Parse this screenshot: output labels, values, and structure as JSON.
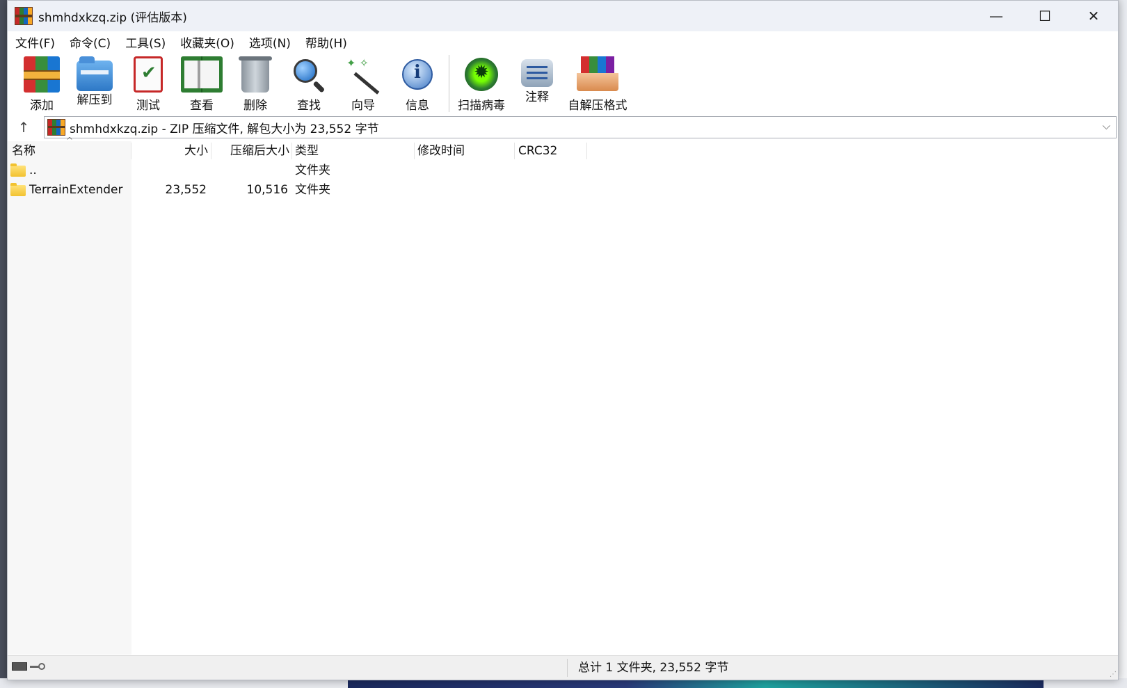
{
  "window": {
    "title": "shmhdxkzq.zip (评估版本)",
    "controls": {
      "minimize": "—",
      "maximize": "☐",
      "close": "✕"
    }
  },
  "menu": [
    "文件(F)",
    "命令(C)",
    "工具(S)",
    "收藏夹(O)",
    "选项(N)",
    "帮助(H)"
  ],
  "toolbar": {
    "group1": [
      {
        "label": "添加",
        "icon": "add-archive-icon"
      },
      {
        "label": "解压到",
        "icon": "extract-to-icon"
      },
      {
        "label": "测试",
        "icon": "test-icon"
      },
      {
        "label": "查看",
        "icon": "view-book-icon"
      },
      {
        "label": "删除",
        "icon": "trash-icon"
      },
      {
        "label": "查找",
        "icon": "magnifier-icon"
      },
      {
        "label": "向导",
        "icon": "wizard-wand-icon"
      },
      {
        "label": "信息",
        "icon": "info-icon"
      }
    ],
    "group2": [
      {
        "label": "扫描病毒",
        "icon": "virus-scan-icon"
      },
      {
        "label": "注释",
        "icon": "comment-icon"
      },
      {
        "label": "自解压格式",
        "icon": "sfx-icon"
      }
    ]
  },
  "address": {
    "up_icon": "↑",
    "text": "shmhdxkzq.zip - ZIP 压缩文件, 解包大小为 23,552 字节",
    "dropdown": "⌵"
  },
  "columns": {
    "name": "名称",
    "size": "大小",
    "packed": "压缩后大小",
    "type": "类型",
    "modified": "修改时间",
    "crc": "CRC32",
    "sort_indicator": "^"
  },
  "rows": [
    {
      "name": "..",
      "size": "",
      "packed": "",
      "type": "文件夹"
    },
    {
      "name": "TerrainExtender",
      "size": "23,552",
      "packed": "10,516",
      "type": "文件夹"
    }
  ],
  "status": {
    "summary": "总计 1 文件夹, 23,552 字节",
    "grip": "⋰"
  }
}
